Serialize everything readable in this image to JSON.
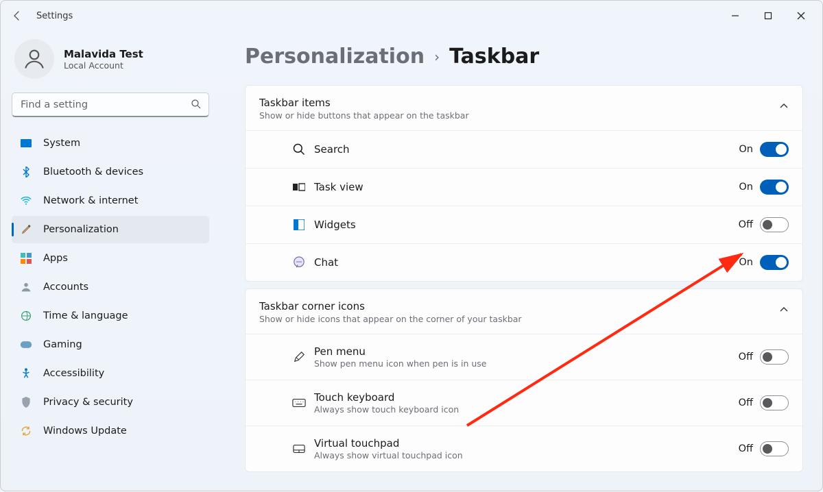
{
  "window": {
    "title": "Settings"
  },
  "user": {
    "name": "Malavida Test",
    "account_type": "Local Account"
  },
  "search": {
    "placeholder": "Find a setting"
  },
  "sidebar": {
    "items": [
      {
        "label": "System"
      },
      {
        "label": "Bluetooth & devices"
      },
      {
        "label": "Network & internet"
      },
      {
        "label": "Personalization"
      },
      {
        "label": "Apps"
      },
      {
        "label": "Accounts"
      },
      {
        "label": "Time & language"
      },
      {
        "label": "Gaming"
      },
      {
        "label": "Accessibility"
      },
      {
        "label": "Privacy & security"
      },
      {
        "label": "Windows Update"
      }
    ],
    "selected_index": 3
  },
  "breadcrumb": {
    "parent": "Personalization",
    "current": "Taskbar"
  },
  "sections": [
    {
      "title": "Taskbar items",
      "subtitle": "Show or hide buttons that appear on the taskbar",
      "expanded": true,
      "rows": [
        {
          "label": "Search",
          "state": "On",
          "on": true
        },
        {
          "label": "Task view",
          "state": "On",
          "on": true
        },
        {
          "label": "Widgets",
          "state": "Off",
          "on": false
        },
        {
          "label": "Chat",
          "state": "On",
          "on": true
        }
      ]
    },
    {
      "title": "Taskbar corner icons",
      "subtitle": "Show or hide icons that appear on the corner of your taskbar",
      "expanded": true,
      "rows": [
        {
          "label": "Pen menu",
          "sub": "Show pen menu icon when pen is in use",
          "state": "Off",
          "on": false
        },
        {
          "label": "Touch keyboard",
          "sub": "Always show touch keyboard icon",
          "state": "Off",
          "on": false
        },
        {
          "label": "Virtual touchpad",
          "sub": "Always show virtual touchpad icon",
          "state": "Off",
          "on": false
        }
      ]
    }
  ]
}
